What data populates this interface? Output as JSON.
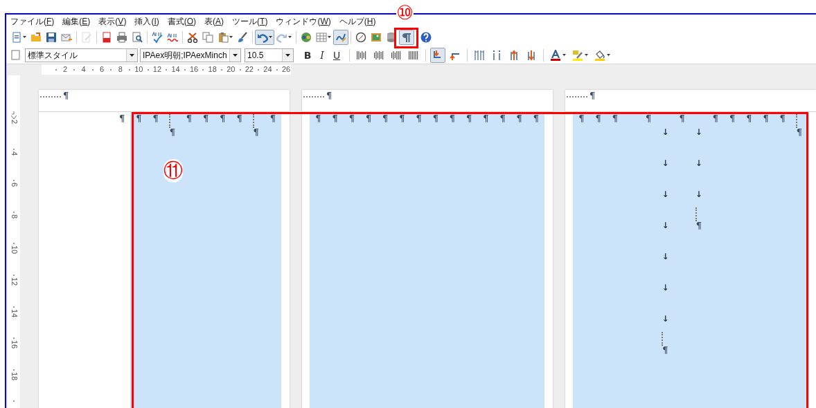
{
  "menu": [
    {
      "before": "ファイル(",
      "key": "F",
      "after": ")"
    },
    {
      "before": "編集(",
      "key": "E",
      "after": ")"
    },
    {
      "before": "表示(",
      "key": "V",
      "after": ")"
    },
    {
      "before": "挿入(",
      "key": "I",
      "after": ")"
    },
    {
      "before": "書式(",
      "key": "O",
      "after": ")"
    },
    {
      "before": "表(",
      "key": "A",
      "after": ")"
    },
    {
      "before": "ツール(",
      "key": "T",
      "after": ")"
    },
    {
      "before": "ウィンドウ(",
      "key": "W",
      "after": ")"
    },
    {
      "before": "ヘルプ(",
      "key": "H",
      "after": ")"
    }
  ],
  "standard_toolbar": [
    {
      "pressed": false,
      "disabled": false
    },
    {
      "pressed": false,
      "disabled": false
    },
    {
      "pressed": false,
      "disabled": false
    },
    {
      "pressed": false,
      "disabled": false
    },
    {
      "pressed": false,
      "disabled": true
    },
    {
      "pressed": false,
      "disabled": false
    },
    {
      "pressed": false,
      "disabled": false
    },
    {
      "pressed": false,
      "disabled": false
    },
    {
      "pressed": false,
      "disabled": false
    },
    {
      "pressed": false,
      "disabled": false
    },
    {
      "pressed": false,
      "disabled": false
    },
    {
      "pressed": false,
      "disabled": false
    },
    {
      "pressed": false,
      "disabled": false
    },
    {
      "pressed": false,
      "disabled": false
    },
    {
      "pressed": true,
      "disabled": false
    },
    {
      "pressed": false,
      "disabled": false
    },
    {
      "pressed": false,
      "disabled": false
    },
    {
      "pressed": false,
      "disabled": false
    },
    {
      "pressed": true,
      "disabled": false
    },
    {
      "pressed": false,
      "disabled": false
    },
    {
      "pressed": false,
      "disabled": false
    },
    {
      "pressed": false,
      "disabled": false
    },
    {
      "pressed": true,
      "disabled": false
    },
    {
      "pressed": false,
      "disabled": false
    }
  ],
  "formatting_toolbar": {
    "paragraph_style": "標準スタイル",
    "font_name": "IPAex明朝;IPAexMinch",
    "font_size": "10.5",
    "text_buttons": [
      {
        "text": "B",
        "pressed": false
      },
      {
        "text": "I",
        "pressed": false
      },
      {
        "text": "U",
        "pressed": false
      }
    ],
    "buttons": [
      {
        "pressed": false
      },
      {
        "pressed": false
      },
      {
        "pressed": false
      },
      {
        "pressed": false
      },
      {
        "pressed": true
      },
      {
        "pressed": false
      },
      {
        "pressed": false
      },
      {
        "pressed": false
      },
      {
        "pressed": false
      },
      {
        "pressed": false
      },
      {
        "pressed": false
      },
      {
        "pressed": false
      },
      {
        "pressed": false
      }
    ]
  },
  "horizontal_ruler": [
    "2",
    "4",
    "6",
    "8",
    "10",
    "12",
    "14",
    "16",
    "18",
    "20",
    "22",
    "24",
    "26"
  ],
  "vertical_ruler": [
    "2",
    "4",
    "6",
    "8",
    "10",
    "12",
    "14",
    "16",
    "18"
  ],
  "pages": [
    {
      "header_mark": "¶",
      "columns": [
        {
          "selected": false,
          "items": [
            {
              "kind": "mark",
              "text": "¶"
            }
          ]
        },
        {
          "selected": true,
          "items": [
            {
              "kind": "mark",
              "text": "¶"
            }
          ]
        },
        {
          "selected": true,
          "items": [
            {
              "kind": "mark",
              "text": "¶"
            }
          ]
        },
        {
          "selected": true,
          "items": [
            {
              "kind": "leader_mark",
              "text": "¶"
            }
          ]
        },
        {
          "selected": true,
          "items": [
            {
              "kind": "mark",
              "text": "¶"
            }
          ]
        },
        {
          "selected": true,
          "items": [
            {
              "kind": "mark",
              "text": "¶"
            }
          ]
        },
        {
          "selected": true,
          "items": [
            {
              "kind": "mark",
              "text": "¶"
            }
          ]
        },
        {
          "selected": true,
          "items": [
            {
              "kind": "mark",
              "text": "¶"
            }
          ]
        },
        {
          "selected": true,
          "items": [
            {
              "kind": "leader_mark",
              "text": "¶"
            }
          ]
        },
        {
          "selected": true,
          "items": [
            {
              "kind": "mark",
              "text": "¶"
            }
          ]
        }
      ]
    },
    {
      "header_mark": "¶",
      "columns": [
        {
          "selected": true,
          "items": [
            {
              "kind": "mark",
              "text": "¶"
            }
          ]
        },
        {
          "selected": true,
          "items": [
            {
              "kind": "mark",
              "text": "¶"
            }
          ]
        },
        {
          "selected": true,
          "items": [
            {
              "kind": "mark",
              "text": "¶"
            }
          ]
        },
        {
          "selected": true,
          "items": [
            {
              "kind": "mark",
              "text": "¶"
            }
          ]
        },
        {
          "selected": true,
          "items": [
            {
              "kind": "mark",
              "text": "¶"
            }
          ]
        },
        {
          "selected": true,
          "items": [
            {
              "kind": "mark",
              "text": "¶"
            }
          ]
        },
        {
          "selected": true,
          "items": [
            {
              "kind": "mark",
              "text": "¶"
            }
          ]
        },
        {
          "selected": true,
          "items": [
            {
              "kind": "mark",
              "text": "¶"
            }
          ]
        },
        {
          "selected": true,
          "items": [
            {
              "kind": "mark",
              "text": "¶"
            }
          ]
        },
        {
          "selected": true,
          "items": [
            {
              "kind": "mark",
              "text": "¶"
            }
          ]
        },
        {
          "selected": true,
          "items": [
            {
              "kind": "mark",
              "text": "¶"
            }
          ]
        },
        {
          "selected": true,
          "items": [
            {
              "kind": "mark",
              "text": "¶"
            }
          ]
        },
        {
          "selected": true,
          "items": [
            {
              "kind": "mark",
              "text": "¶"
            }
          ]
        },
        {
          "selected": true,
          "items": [
            {
              "kind": "mark",
              "text": "¶"
            }
          ]
        }
      ]
    },
    {
      "header_mark": "¶",
      "columns": [
        {
          "selected": true,
          "items": [
            {
              "kind": "mark",
              "text": "¶"
            }
          ]
        },
        {
          "selected": true,
          "items": [
            {
              "kind": "mark",
              "text": "¶"
            }
          ]
        },
        {
          "selected": true,
          "items": [
            {
              "kind": "mark",
              "text": "¶"
            }
          ]
        },
        {
          "selected": true
        },
        {
          "selected": true,
          "items": [
            {
              "kind": "mark",
              "text": "¶"
            }
          ]
        },
        {
          "selected": true,
          "items": [
            {
              "kind": "tab",
              "text": "↓"
            },
            {
              "kind": "tab",
              "text": "↓"
            },
            {
              "kind": "tab",
              "text": "↓"
            },
            {
              "kind": "tab",
              "text": "↓"
            },
            {
              "kind": "tab",
              "text": "↓"
            },
            {
              "kind": "tab",
              "text": "↓"
            },
            {
              "kind": "tab",
              "text": "↓"
            },
            {
              "kind": "leader_mark",
              "text": "¶"
            }
          ]
        },
        {
          "selected": true,
          "items": [
            {
              "kind": "mark",
              "text": "¶"
            }
          ]
        },
        {
          "selected": true,
          "items": [
            {
              "kind": "tab",
              "text": "↓"
            },
            {
              "kind": "tab",
              "text": "↓"
            },
            {
              "kind": "tab",
              "text": "↓"
            },
            {
              "kind": "leader_mark",
              "text": "¶"
            }
          ]
        },
        {
          "selected": true,
          "items": [
            {
              "kind": "mark",
              "text": "¶"
            }
          ]
        },
        {
          "selected": true,
          "items": [
            {
              "kind": "mark",
              "text": "¶"
            }
          ]
        },
        {
          "selected": true,
          "items": [
            {
              "kind": "mark",
              "text": "¶"
            }
          ]
        },
        {
          "selected": true,
          "items": [
            {
              "kind": "mark",
              "text": "¶"
            }
          ]
        },
        {
          "selected": true,
          "items": [
            {
              "kind": "mark",
              "text": "¶"
            }
          ]
        },
        {
          "selected": true,
          "items": [
            {
              "kind": "leader_mark",
              "text": "¶"
            }
          ]
        }
      ]
    }
  ],
  "annotations": [
    {
      "label": "⑩"
    },
    {
      "label": "⑪"
    }
  ]
}
